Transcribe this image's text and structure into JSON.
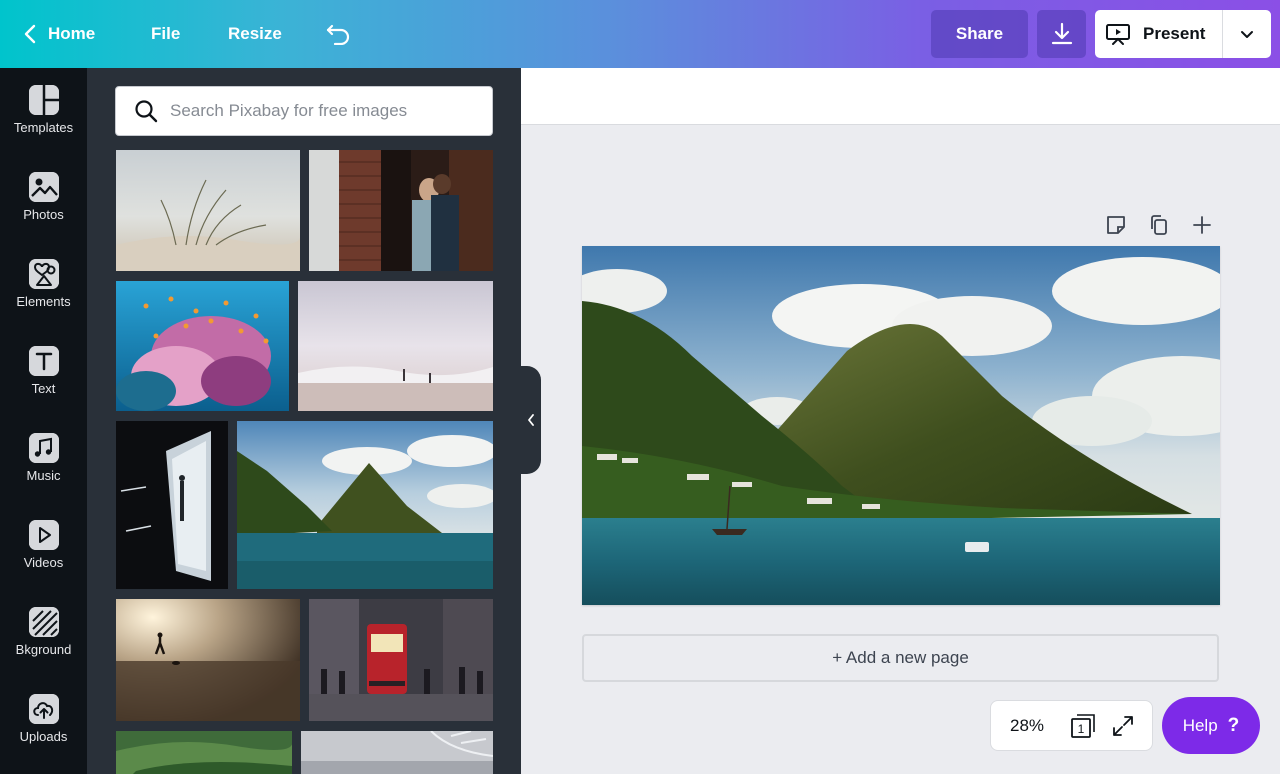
{
  "topbar": {
    "home_label": "Home",
    "file_label": "File",
    "resize_label": "Resize",
    "share_label": "Share",
    "present_label": "Present"
  },
  "rail": {
    "items": [
      {
        "label": "Templates",
        "icon": "templates-icon"
      },
      {
        "label": "Photos",
        "icon": "photos-icon"
      },
      {
        "label": "Elements",
        "icon": "elements-icon"
      },
      {
        "label": "Text",
        "icon": "text-icon"
      },
      {
        "label": "Music",
        "icon": "music-icon"
      },
      {
        "label": "Videos",
        "icon": "videos-icon"
      },
      {
        "label": "Bkground",
        "icon": "background-icon"
      },
      {
        "label": "Uploads",
        "icon": "uploads-icon"
      }
    ]
  },
  "panel": {
    "search_placeholder": "Search Pixabay for free images"
  },
  "canvas": {
    "add_page_label": "+ Add a new page"
  },
  "footer": {
    "zoom": "28%",
    "page_count": "1",
    "help_label": "Help",
    "help_symbol": "?"
  },
  "colors": {
    "brand_purple": "#7d2ae8",
    "panel_bg": "#293039",
    "rail_bg": "#0e1318",
    "gradient_start": "#00c4cc",
    "gradient_end": "#8b4fe6"
  }
}
